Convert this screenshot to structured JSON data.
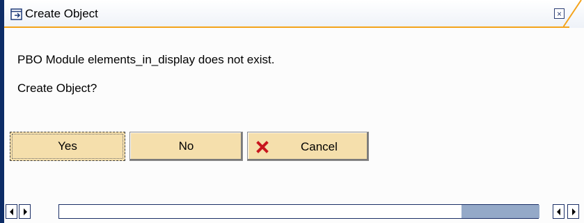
{
  "window": {
    "title": "Create Object",
    "close_symbol": "×"
  },
  "message": {
    "line1": "PBO Module elements_in_display does not exist.",
    "line2": "Create Object?"
  },
  "buttons": {
    "yes": "Yes",
    "no": "No",
    "cancel": "Cancel"
  },
  "icons": {
    "title": "create-object-icon",
    "cancel": "red-x-icon",
    "scroll_left": "arrow-left-icon",
    "scroll_right": "arrow-right-icon"
  },
  "colors": {
    "button_face": "#f5dfac",
    "accent": "#f4a31b",
    "frame": "#0d2c66",
    "scroll_thumb": "#94a9c8"
  }
}
